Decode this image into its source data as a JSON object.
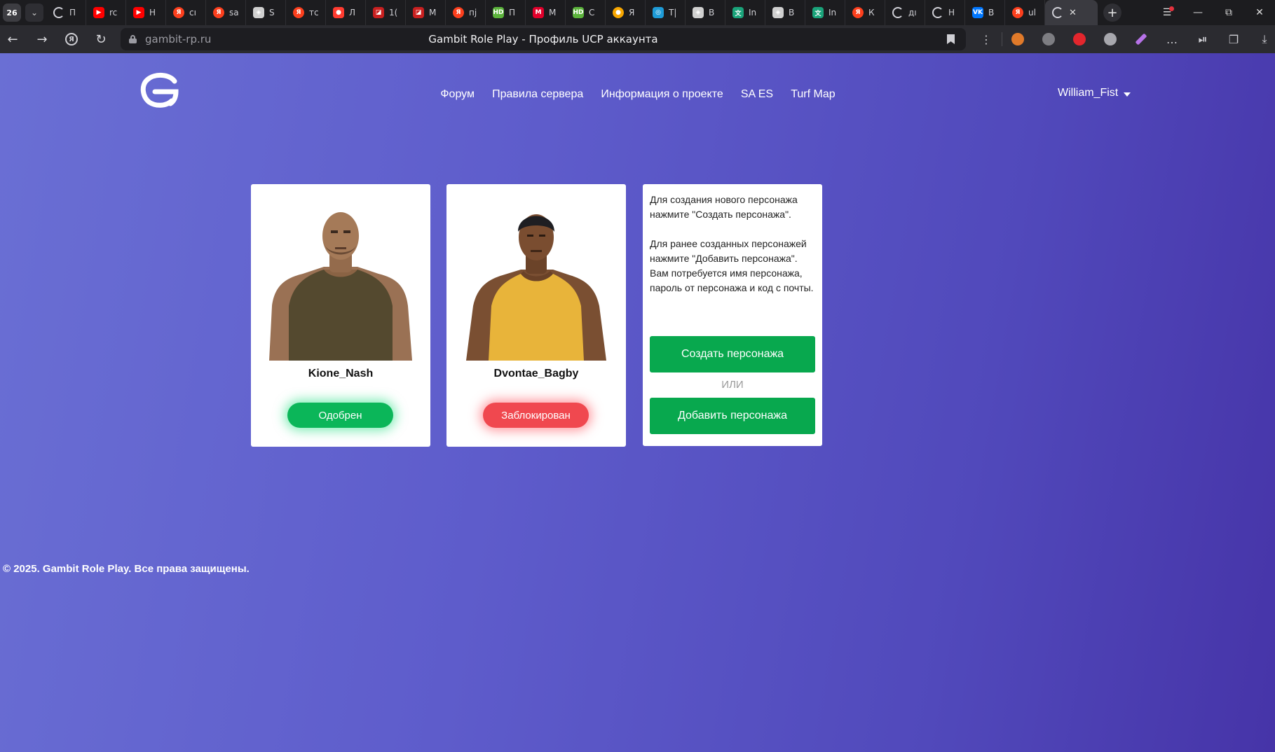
{
  "browser": {
    "tab_count": "26",
    "tabs": [
      {
        "icon": "gambit-icon",
        "title": "П",
        "color": "#ffffff"
      },
      {
        "icon": "youtube-icon",
        "title": "rc",
        "color": "#ff0000"
      },
      {
        "icon": "youtube-icon",
        "title": "Н",
        "color": "#ff0000"
      },
      {
        "icon": "yandex-icon",
        "title": "cı",
        "color": "#fc3f1d"
      },
      {
        "icon": "yandex-icon",
        "title": "sa",
        "color": "#fc3f1d"
      },
      {
        "icon": "game-icon",
        "title": "S",
        "color": "#d0d0d0"
      },
      {
        "icon": "yandex-icon",
        "title": "тс",
        "color": "#fc3f1d"
      },
      {
        "icon": "video-icon",
        "title": "Л",
        "color": "#ff3b30"
      },
      {
        "icon": "dota-icon",
        "title": "1(",
        "color": "#c82020"
      },
      {
        "icon": "dota-icon",
        "title": "М",
        "color": "#c82020"
      },
      {
        "icon": "yandex-icon",
        "title": "пј",
        "color": "#fc3f1d"
      },
      {
        "icon": "hd-icon",
        "title": "П",
        "color": "#5bb33b"
      },
      {
        "icon": "m-icon",
        "title": "М",
        "color": "#e1002b"
      },
      {
        "icon": "hd-icon",
        "title": "С",
        "color": "#5bb33b"
      },
      {
        "icon": "fire-icon",
        "title": "Я",
        "color": "#f7a600"
      },
      {
        "icon": "app-icon",
        "title": "Т|",
        "color": "#1e9bd7"
      },
      {
        "icon": "game-icon",
        "title": "В",
        "color": "#d0d0d0"
      },
      {
        "icon": "translate-icon",
        "title": "In",
        "color": "#1aa37a"
      },
      {
        "icon": "game-icon",
        "title": "В",
        "color": "#d0d0d0"
      },
      {
        "icon": "translate-icon",
        "title": "In",
        "color": "#1aa37a"
      },
      {
        "icon": "yandex-icon",
        "title": "К",
        "color": "#fc3f1d"
      },
      {
        "icon": "gambit-icon",
        "title": "дı",
        "color": "#ffffff"
      },
      {
        "icon": "gambit-icon",
        "title": "Н",
        "color": "#ffffff"
      },
      {
        "icon": "vk-icon",
        "title": "В",
        "color": "#0077ff"
      },
      {
        "icon": "yandex-icon",
        "title": "ul",
        "color": "#fc3f1d"
      }
    ],
    "url": "gambit-rp.ru",
    "page_title": "Gambit Role Play - Профиль UCP аккаунта",
    "tools": [
      "menu-dots",
      "ext-1",
      "ext-2",
      "ext-3",
      "ext-4",
      "ext-5",
      "more",
      "media",
      "collections",
      "downloads"
    ]
  },
  "header": {
    "nav": [
      "Форум",
      "Правила сервера",
      "Информация о проекте",
      "SA ES",
      "Turf Map"
    ],
    "username": "William_Fist"
  },
  "characters": [
    {
      "name": "Kione_Nash",
      "status": "Одобрен",
      "status_color": "#0bb659"
    },
    {
      "name": "Dvontae_Bagby",
      "status": "Заблокирован",
      "status_color": "#f0484f"
    }
  ],
  "info": {
    "text_1": "Для создания нового персонажа нажмите \"Создать персонажа\".",
    "text_2": "Для ранее созданных персонажей нажмите \"Добавить персонажа\". Вам потребуется имя персонажа, пароль от персонажа и код с почты.",
    "create_button": "Создать персонажа",
    "or_label": "ИЛИ",
    "add_button": "Добавить персонажа"
  },
  "footer": {
    "copyright": "© 2025. Gambit Role Play. Все права защищены."
  },
  "colors": {
    "accent_green": "#08a84e",
    "gradient_start": "#6a6fd4",
    "gradient_end": "#4634a8"
  }
}
